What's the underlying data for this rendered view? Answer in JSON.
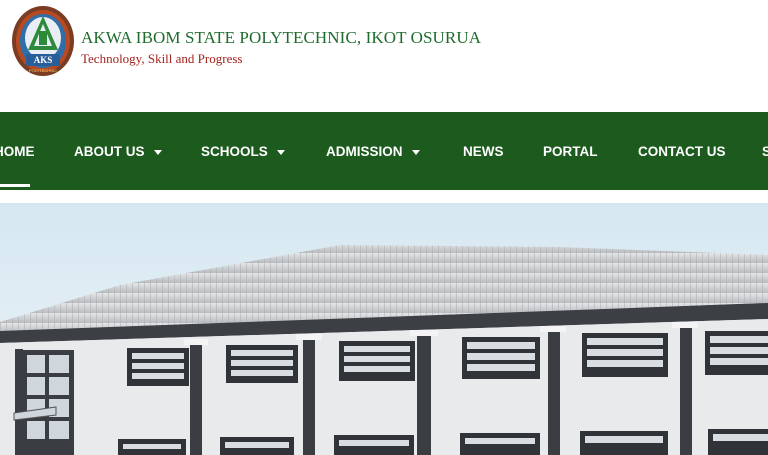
{
  "header": {
    "school_name": "AKWA IBOM STATE POLYTECHNIC, IKOT OSURUA",
    "tagline": "Technology, Skill and Progress"
  },
  "nav": {
    "items": [
      {
        "label": "HOME",
        "active": true
      },
      {
        "label": "ABOUT US",
        "dropdown": true
      },
      {
        "label": "SCHOOLS",
        "dropdown": true
      },
      {
        "label": "ADMISSION",
        "dropdown": true
      },
      {
        "label": "NEWS"
      },
      {
        "label": "PORTAL"
      },
      {
        "label": "CONTACT US"
      },
      {
        "label": "S"
      }
    ]
  },
  "hero": {
    "image": "campus-building-photo"
  },
  "colors": {
    "nav_bg": "#1d5a1e",
    "title_green": "#1f6b2c",
    "tagline_red": "#a2231d"
  }
}
